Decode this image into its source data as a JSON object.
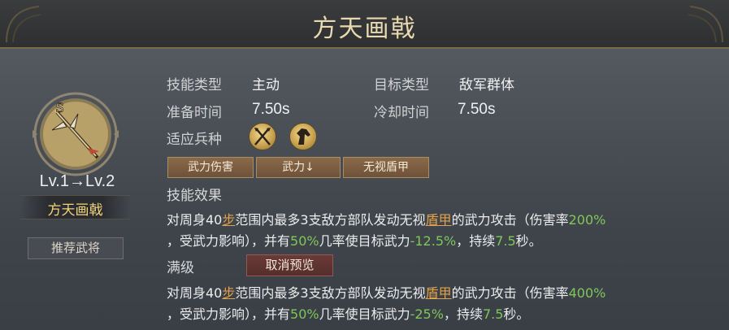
{
  "title": "方天画戟",
  "skill": {
    "level_text": "Lv.1→Lv.2",
    "name": "方天画戟",
    "recommend_button": "推荐武将"
  },
  "info": {
    "type_label": "技能类型",
    "type_value": "主动",
    "target_label": "目标类型",
    "target_value": "敌军群体",
    "prep_label": "准备时间",
    "prep_value": "7.50s",
    "cooldown_label": "冷却时间",
    "cooldown_value": "7.50s",
    "unit_label": "适应兵种",
    "unit_icons": [
      "crossed-halberds-icon",
      "horse-head-icon"
    ]
  },
  "tags": [
    "武力伤害",
    "武力↓",
    "无视盾甲"
  ],
  "effect": {
    "label": "技能效果",
    "p1": "对周身40",
    "bu": "步",
    "p2": "范围内最多3支敌方部队发动无视",
    "dunjia": "盾甲",
    "p3": "的武力攻击（伤害率",
    "rate": "200%",
    "p4": "，受武力影响），并有",
    "chance": "50%",
    "p5": "几率使目标武力",
    "reduce": "-12.5%",
    "p6": "，持续",
    "duration": "7.5",
    "p7": "秒。"
  },
  "max": {
    "label": "满级",
    "cancel_button": "取消预览",
    "p1": "对周身40",
    "bu": "步",
    "p2": "范围内最多3支敌方部队发动无视",
    "dunjia": "盾甲",
    "p3": "的武力攻击（伤害率",
    "rate": "400%",
    "p4": "，受武力影响），并有",
    "chance": "50%",
    "p5": "几率使目标武力",
    "reduce": "-25%",
    "p6": "，持续",
    "duration": "7.5",
    "p7": "秒。"
  },
  "colors": {
    "gold": "#f0d27a",
    "green": "#7ec85a",
    "orange": "#e0a24a",
    "tag_bg": "#7a5c40"
  }
}
